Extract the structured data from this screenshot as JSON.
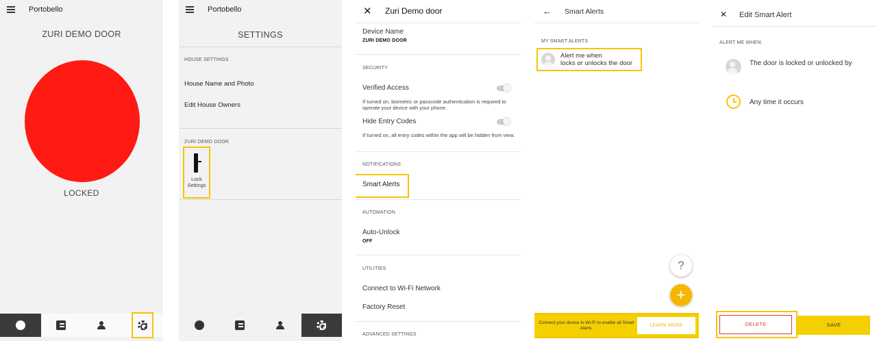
{
  "colors": {
    "accent_yellow": "#f5c400",
    "lock_red": "#ff1a14",
    "delete_red": "#d9392c",
    "nav_dark": "#3a3a3a"
  },
  "panel1": {
    "house_name": "Portobello",
    "door_title": "ZURI DEMO DOOR",
    "status": "LOCKED",
    "nav_icons": [
      "circle-icon",
      "list-icon",
      "users-icon",
      "gear-icon"
    ]
  },
  "panel2": {
    "house_name": "Portobello",
    "title": "SETTINGS",
    "house_settings_label": "HOUSE SETTINGS",
    "house_name_photo": "House Name and Photo",
    "edit_owners": "Edit House Owners",
    "door_section_label": "ZURI DEMO DOOR",
    "lock_settings_label": "Lock Settings",
    "nav_icons": [
      "circle-icon",
      "list-icon",
      "users-icon",
      "gear-icon"
    ]
  },
  "panel3": {
    "title": "Zuri Demo door",
    "device_name_label": "Device Name",
    "device_name_value": "ZURI DEMO DOOR",
    "security_label": "SECURITY",
    "verified_access": "Verified Access",
    "verified_access_help": "If turned on, biometric or passcode authentication is required to operate your device with your phone.",
    "hide_entry_codes": "Hide Entry Codes",
    "hide_entry_codes_help": "If turned on, all entry codes within the app will be hidden from view.",
    "notifications_label": "NOTIFICATIONS",
    "smart_alerts": "Smart Alerts",
    "automation_label": "AUTOMATION",
    "auto_unlock": "Auto-Unlock",
    "auto_unlock_value": "OFF",
    "utilities_label": "UTILITIES",
    "connect_wifi": "Connect to Wi-Fi Network",
    "factory_reset": "Factory Reset",
    "advanced_settings_label": "ADVANCED SETTINGS"
  },
  "panel4": {
    "title": "Smart Alerts",
    "my_smart_alerts_label": "MY SMART ALERTS",
    "alert_line1": "Alert me when",
    "alert_line2": "locks or unlocks the door",
    "help_glyph": "?",
    "add_glyph": "+",
    "banner_message": "Connect your device to Wi-Fi to enable all Smart Alerts.",
    "learn_more": "LEARN MORE"
  },
  "panel5": {
    "title": "Edit Smart Alert",
    "alert_me_when_label": "ALERT ME WHEN:",
    "condition_1": "The door is locked or unlocked by",
    "condition_2": "Any time it occurs",
    "delete": "DELETE",
    "save": "SAVE"
  }
}
